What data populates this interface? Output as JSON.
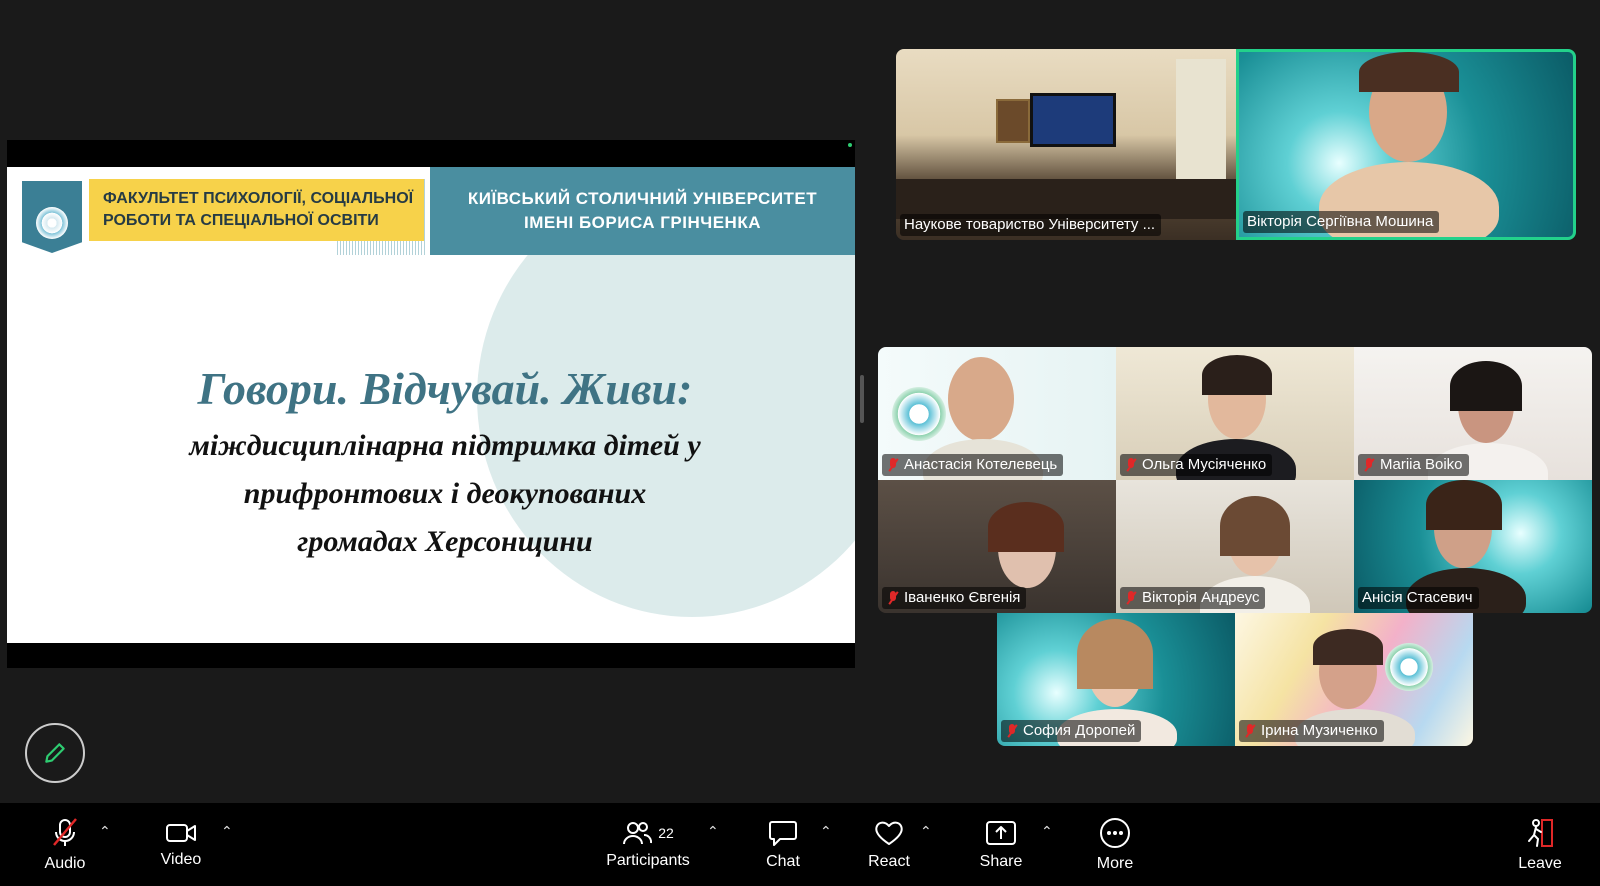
{
  "slide": {
    "faculty_line1": "ФАКУЛЬТЕТ ПСИХОЛОГІЇ, СОЦІАЛЬНОЇ",
    "faculty_line2": "РОБОТИ ТА СПЕЦІАЛЬНОЇ ОСВІТИ",
    "university_line1": "КИЇВСЬКИЙ СТОЛИЧНИЙ УНІВЕРСИТЕТ",
    "university_line2": "ІМЕНІ БОРИСА ГРІНЧЕНКА",
    "title": "Говори. Відчувай. Живи:",
    "subtitle_line1": "міждисциплінарна підтримка дітей у",
    "subtitle_line2": "прифронтових і деокупованих",
    "subtitle_line3": "громадах Херсонщини",
    "colors": {
      "accent": "#4a8ea0",
      "yellow": "#f7d24a",
      "title": "#3f7384"
    }
  },
  "top_tiles": [
    {
      "name": "Наукове товариство Університету ...",
      "muted": false
    },
    {
      "name": "Вікторія Сергіївна Мошина",
      "muted": false,
      "active_speaker": true
    }
  ],
  "gallery": [
    {
      "name": "Анастасія Котелевець",
      "muted": true
    },
    {
      "name": "Ольга Мусіяченко",
      "muted": true
    },
    {
      "name": "Mariia Boiko",
      "muted": true
    },
    {
      "name": "Іваненко Євгенія",
      "muted": true
    },
    {
      "name": "Вікторія Андреус",
      "muted": true
    },
    {
      "name": "Анісія Стасевич",
      "muted": false
    },
    {
      "name": "София Доропей",
      "muted": true
    },
    {
      "name": "Ірина Музиченко",
      "muted": true
    }
  ],
  "toolbar": {
    "audio": "Audio",
    "video": "Video",
    "participants": "Participants",
    "participants_count": "22",
    "chat": "Chat",
    "react": "React",
    "share": "Share",
    "more": "More",
    "leave": "Leave"
  },
  "colors": {
    "active_speaker_border": "#23d18b",
    "muted": "#e02828",
    "leave": "#e02828"
  }
}
